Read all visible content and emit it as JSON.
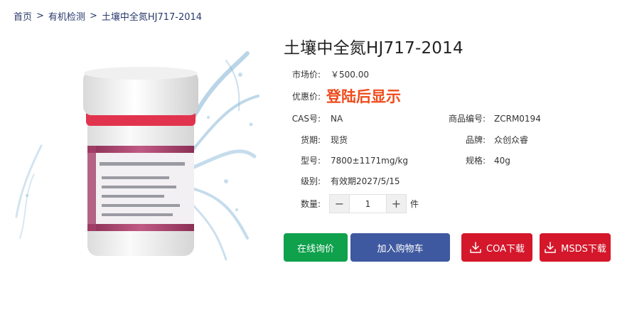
{
  "breadcrumb": {
    "home": "首页",
    "sep": ">",
    "category": "有机检测",
    "current": "土壤中全氮HJ717-2014"
  },
  "product": {
    "title": "土壤中全氮HJ717-2014",
    "market_price_label": "市场价:",
    "market_price": "￥500.00",
    "promo_label": "优惠价:",
    "promo_text": "登陆后显示",
    "cas_label": "CAS号:",
    "cas": "NA",
    "code_label": "商品编号:",
    "code": "ZCRM0194",
    "stock_label": "货期:",
    "stock": "现货",
    "brand_label": "品牌:",
    "brand": "众创众睿",
    "model_label": "型号:",
    "model": "7800±1171mg/kg",
    "spec_label": "规格:",
    "spec": "40g",
    "grade_label": "级别:",
    "grade": "有效期2027/5/15",
    "qty_label": "数量:",
    "qty_minus": "−",
    "qty_value": "1",
    "qty_plus": "+",
    "qty_unit": "件"
  },
  "actions": {
    "inquire": "在线询价",
    "cart": "加入购物车",
    "coa": "COA下载",
    "msds": "MSDS下载"
  },
  "colors": {
    "green": "#0fa14c",
    "blue": "#3f59a0",
    "red": "#d4172b",
    "promo": "#f04a1a",
    "link": "#2a3a6b"
  },
  "icons": {
    "download": "download-icon"
  }
}
